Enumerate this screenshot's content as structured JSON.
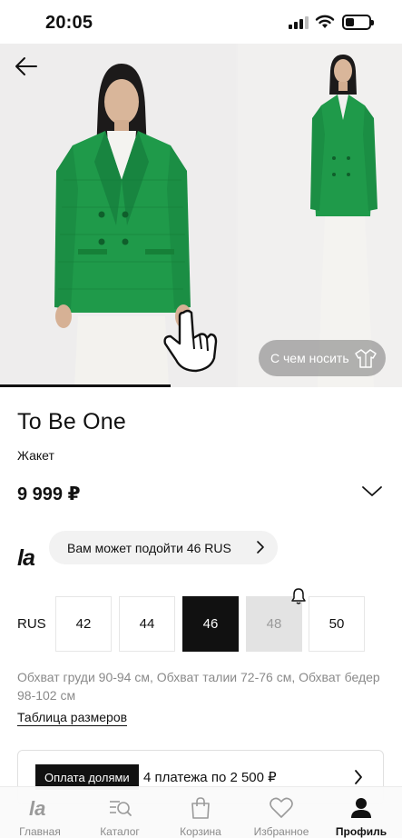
{
  "status_bar": {
    "time": "20:05"
  },
  "gallery": {
    "wear_button": "С чем носить"
  },
  "product": {
    "brand": "To Be One",
    "type": "Жакет",
    "price": "9 999 ₽"
  },
  "fit": {
    "logo": "la",
    "text": "Вам может подойти 46 RUS"
  },
  "sizes": {
    "system": "RUS",
    "items": [
      {
        "label": "42",
        "state": "available"
      },
      {
        "label": "44",
        "state": "available"
      },
      {
        "label": "46",
        "state": "selected"
      },
      {
        "label": "48",
        "state": "unavailable"
      },
      {
        "label": "50",
        "state": "available"
      }
    ]
  },
  "measurements": "Обхват груди 90-94 см, Обхват талии 72-76 см, Обхват бедер 98-102 см",
  "size_table_link": "Таблица размеров",
  "installment": {
    "badge": "Оплата долями",
    "text": "4 платежа по 2 500 ₽"
  },
  "nav": {
    "items": [
      {
        "label": "Главная",
        "icon": "la-logo-icon"
      },
      {
        "label": "Каталог",
        "icon": "catalog-search-icon"
      },
      {
        "label": "Корзина",
        "icon": "bag-icon"
      },
      {
        "label": "Избранное",
        "icon": "heart-icon"
      },
      {
        "label": "Профиль",
        "icon": "profile-icon"
      }
    ],
    "active_index": 4
  },
  "colors": {
    "jacket_green": "#1f9a4a",
    "accent": "#111111"
  }
}
